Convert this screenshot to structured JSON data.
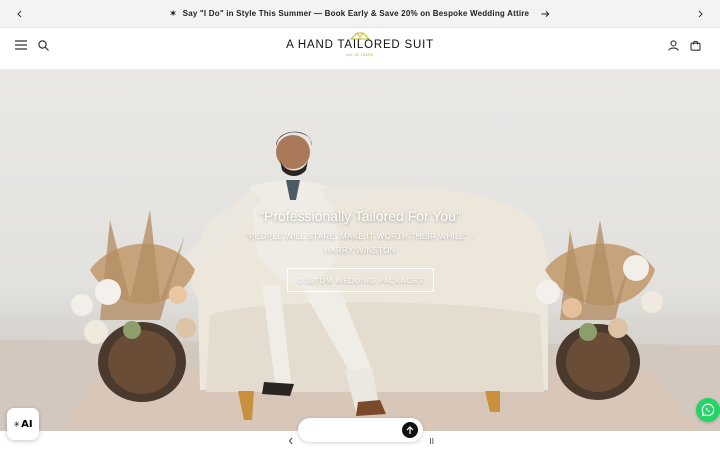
{
  "announcement": {
    "star": "✶",
    "text": "Say \"I Do\" in Style This Summer — Book Early & Save 20% on Bespoke Wedding Attire",
    "icons": {
      "prev": "chevron-left-icon",
      "next": "chevron-right-icon",
      "link": "arrow-right-icon"
    }
  },
  "header": {
    "logo_name": "A HAND TAILORED SUIT",
    "logo_tagline": "est. 20 YEARS",
    "icons": {
      "menu": "hamburger-menu-icon",
      "search": "search-icon",
      "account": "user-icon",
      "cart": "shopping-bag-icon"
    }
  },
  "hero": {
    "title": "\"Professionally Tailored For You\"",
    "quote": "\"PEOPLE WILL STARE. MAKE IT WORTH THEIR WHILE\" - HARRY WINSTON",
    "button_label": "CUSTOM WEDDING PACKAGES"
  },
  "slideshow": {
    "pause_label": "II",
    "icons": {
      "prev": "chevron-left-icon",
      "pause": "pause-icon"
    }
  },
  "widgets": {
    "ai_badge_label": "AI",
    "whatsapp_icon": "whatsapp-icon",
    "send_icon": "arrow-up-icon"
  },
  "colors": {
    "accent_logo": "#b8b02a",
    "whatsapp": "#25d366",
    "announcement_bg": "#f3f3f3"
  }
}
